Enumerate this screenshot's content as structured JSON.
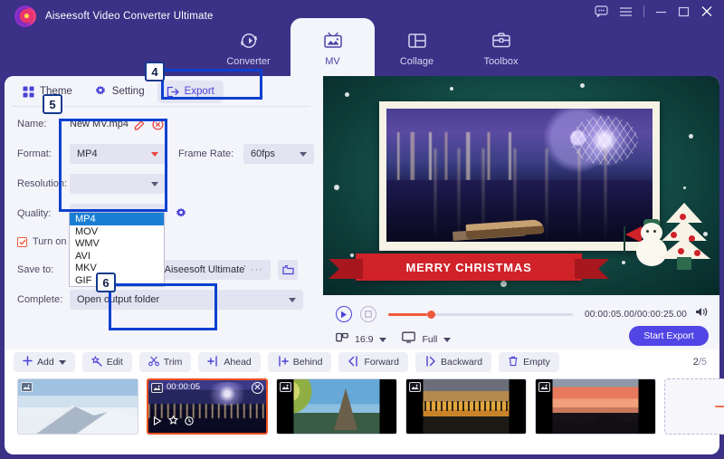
{
  "window": {
    "app_title": "Aiseesoft Video Converter Ultimate",
    "controls": {
      "feedback": "feedback-icon",
      "menu": "hamburger-menu-icon",
      "minimize": "minimize-icon",
      "maximize": "maximize-icon",
      "close": "close-icon"
    }
  },
  "nav": {
    "tabs": [
      {
        "label": "Converter",
        "icon": "converter-icon",
        "active": false
      },
      {
        "label": "MV",
        "icon": "mv-icon",
        "active": true
      },
      {
        "label": "Collage",
        "icon": "collage-icon",
        "active": false
      },
      {
        "label": "Toolbox",
        "icon": "toolbox-icon",
        "active": false
      }
    ]
  },
  "subtabs": [
    {
      "label": "Theme",
      "icon": "theme-icon",
      "active": false
    },
    {
      "label": "Setting",
      "icon": "gear-icon",
      "active": false
    },
    {
      "label": "Export",
      "icon": "export-icon",
      "active": true
    }
  ],
  "export_form": {
    "name_label": "Name:",
    "name_value": "New MV.mp4",
    "format_label": "Format:",
    "format_value": "MP4",
    "format_options": [
      "MP4",
      "MOV",
      "WMV",
      "AVI",
      "MKV",
      "GIF"
    ],
    "format_selected": "MP4",
    "framerate_label": "Frame Rate:",
    "framerate_value": "60fps",
    "resolution_label": "Resolution:",
    "quality_label": "Quality:",
    "gpu_label": "Turn on GPU Acceleration",
    "gpu_checked": true,
    "saveto_label": "Save to:",
    "saveto_value": "C:\\Aiseesoft Studio\\Aiseesoft Ultimate\\MV Exported",
    "browse_dots": "···",
    "folder_icon": "folder-icon",
    "complete_label": "Complete:",
    "complete_value": "Open output folder",
    "start_export_label": "Start Export"
  },
  "preview": {
    "overlay_text": "MERRY CHRISTMAS",
    "play_icon": "play-icon",
    "stop_icon": "stop-icon",
    "current_time": "00:00:05.00",
    "total_time": "00:00:25.00",
    "timecode": "00:00:05.00/00:00:25.00",
    "volume_icon": "volume-icon",
    "aspect_ratio_label": "16:9",
    "aspect_ratio_icon": "aspect-ratio-icon",
    "screen_mode_label": "Full",
    "screen_mode_icon": "monitor-icon",
    "start_export_label": "Start Export",
    "progress_percent": 20
  },
  "toolbar": {
    "buttons": [
      {
        "label": "Add",
        "icon": "plus-icon",
        "has_caret": true
      },
      {
        "label": "Edit",
        "icon": "edit-wand-icon",
        "has_caret": false
      },
      {
        "label": "Trim",
        "icon": "scissors-icon",
        "has_caret": false
      },
      {
        "label": "Ahead",
        "icon": "insert-ahead-icon",
        "has_caret": false
      },
      {
        "label": "Behind",
        "icon": "insert-behind-icon",
        "has_caret": false
      },
      {
        "label": "Forward",
        "icon": "move-forward-icon",
        "has_caret": false
      },
      {
        "label": "Backward",
        "icon": "move-backward-icon",
        "has_caret": false
      },
      {
        "label": "Empty",
        "icon": "trash-icon",
        "has_caret": false
      }
    ],
    "counter_current": "2",
    "counter_sep": "/",
    "counter_total": "5"
  },
  "media_strip": {
    "items": [
      {
        "name": "snow-mountain",
        "duration": "",
        "active": false
      },
      {
        "name": "city-night",
        "duration": "00:00:05",
        "active": true
      },
      {
        "name": "eiffel-tower",
        "duration": "",
        "active": false
      },
      {
        "name": "golden-skyline",
        "duration": "",
        "active": false
      },
      {
        "name": "dusk-mountain",
        "duration": "",
        "active": false
      }
    ],
    "add_label": "+",
    "close_glyph": "✕"
  },
  "callouts": [
    {
      "number": "4",
      "target": "export-subtab"
    },
    {
      "number": "5",
      "target": "format-dropdown"
    },
    {
      "number": "6",
      "target": "start-export-button"
    }
  ],
  "colors": {
    "brand_purple": "#3b3186",
    "accent_blue": "#5145e5",
    "highlight_blue": "#0b41d0",
    "accent_orange": "#f05a3c",
    "panel_bg": "#f4f4fb",
    "ribbon_red": "#cf2229"
  }
}
